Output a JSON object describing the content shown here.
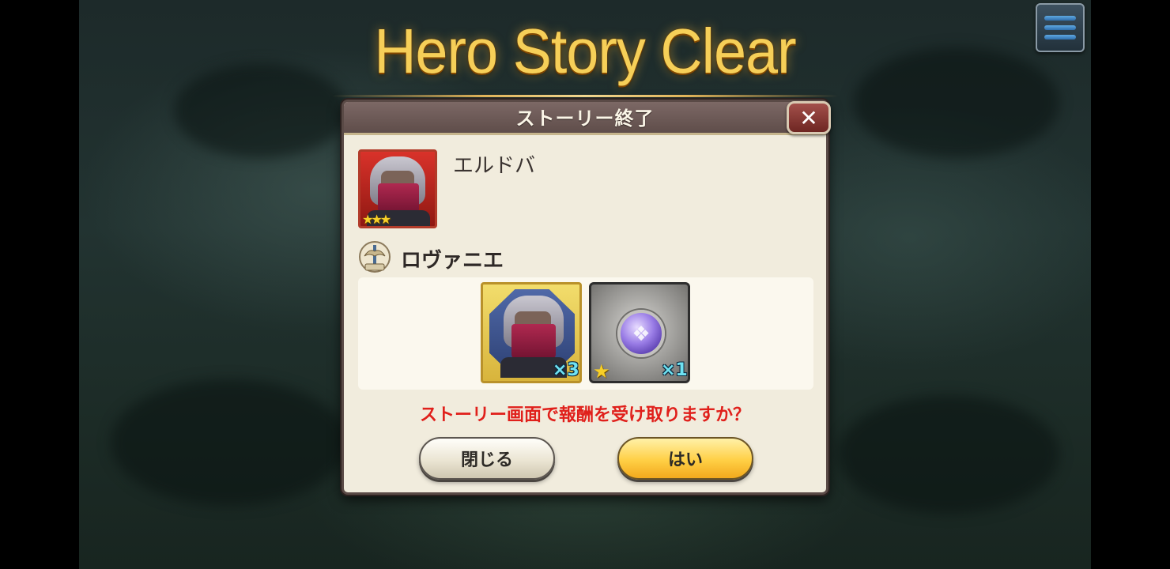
{
  "banner": {
    "title": "Hero Story Clear"
  },
  "dialog": {
    "title": "ストーリー終了",
    "close_icon": "close-icon",
    "hero": {
      "name": "エルドバ",
      "stars": "★★★"
    },
    "story": {
      "icon": "story-icon",
      "name": "ロヴァニエ"
    },
    "rewards": [
      {
        "type": "hero-shard",
        "quantity": "×3"
      },
      {
        "type": "orb",
        "star": "★",
        "quantity": "×1"
      }
    ],
    "question": "ストーリー画面で報酬を受け取りますか？",
    "buttons": {
      "close_label": "閉じる",
      "yes_label": "はい"
    }
  },
  "menu": {
    "icon": "hamburger-menu-icon"
  },
  "colors": {
    "accent_red": "#e0201b",
    "header": "#6e5b58",
    "panel": "#f1ecdd",
    "yes_button": "#ffcf45",
    "title_gold": "#f6cf58"
  }
}
